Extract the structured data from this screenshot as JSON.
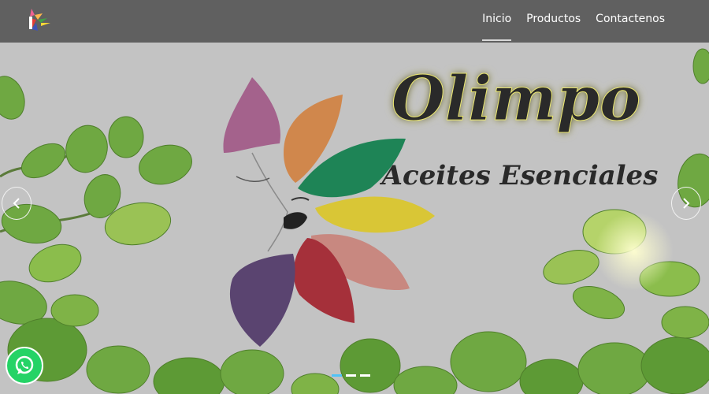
{
  "nav": {
    "items": [
      {
        "label": "Inicio",
        "active": true
      },
      {
        "label": "Productos",
        "active": false
      },
      {
        "label": "Contactenos",
        "active": false
      }
    ]
  },
  "hero": {
    "brand_title": "Olimpo",
    "brand_subtitle": "Aceites Esenciales",
    "slide_count": 3,
    "active_slide": 1
  },
  "icons": {
    "prev": "chevron-left-icon",
    "next": "chevron-right-icon",
    "whatsapp": "whatsapp-icon",
    "logo": "olimpo-logo-icon"
  },
  "colors": {
    "navbar": "#606060",
    "indicator_active": "#4fc3f7",
    "whatsapp": "#25d366"
  }
}
